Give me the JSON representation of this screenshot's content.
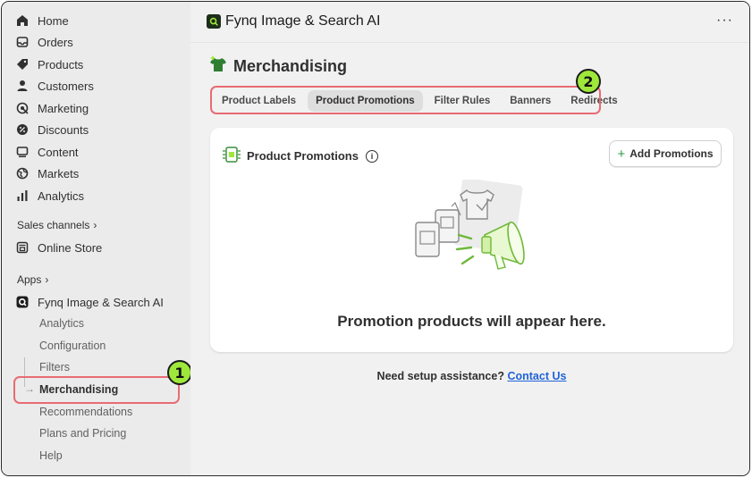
{
  "sidebar": {
    "nav": [
      {
        "label": "Home",
        "icon": "home-icon"
      },
      {
        "label": "Orders",
        "icon": "orders-icon"
      },
      {
        "label": "Products",
        "icon": "tag-icon"
      },
      {
        "label": "Customers",
        "icon": "person-icon"
      },
      {
        "label": "Marketing",
        "icon": "target-icon"
      },
      {
        "label": "Discounts",
        "icon": "discount-icon"
      },
      {
        "label": "Content",
        "icon": "content-icon"
      },
      {
        "label": "Markets",
        "icon": "globe-icon"
      },
      {
        "label": "Analytics",
        "icon": "bar-chart-icon"
      }
    ],
    "sales_channels_label": "Sales channels",
    "online_store": "Online Store",
    "apps_label": "Apps",
    "app_name": "Fynq Image & Search AI",
    "sub_items": [
      "Analytics",
      "Configuration",
      "Filters",
      "Merchandising",
      "Recommendations",
      "Plans and Pricing",
      "Help"
    ],
    "active_sub_item": "Merchandising"
  },
  "badges": {
    "one": "1",
    "two": "2"
  },
  "header": {
    "app_title": "Fynq Image & Search AI",
    "more": "···"
  },
  "page": {
    "title": "Merchandising"
  },
  "tabs": [
    {
      "label": "Product Labels",
      "active": false
    },
    {
      "label": "Product Promotions",
      "active": true
    },
    {
      "label": "Filter Rules",
      "active": false
    },
    {
      "label": "Banners",
      "active": false
    },
    {
      "label": "Redirects",
      "active": false
    }
  ],
  "card": {
    "title": "Product Promotions",
    "info": "i",
    "add_button": "Add Promotions",
    "add_plus": "+",
    "empty_text": "Promotion products will appear here."
  },
  "assist": {
    "text": "Need setup assistance?",
    "link": "Contact Us"
  },
  "colors": {
    "highlight": "#e86b73",
    "badge": "#9ee83b",
    "link": "#1f63d8",
    "accent_green": "#2a9d4a"
  }
}
